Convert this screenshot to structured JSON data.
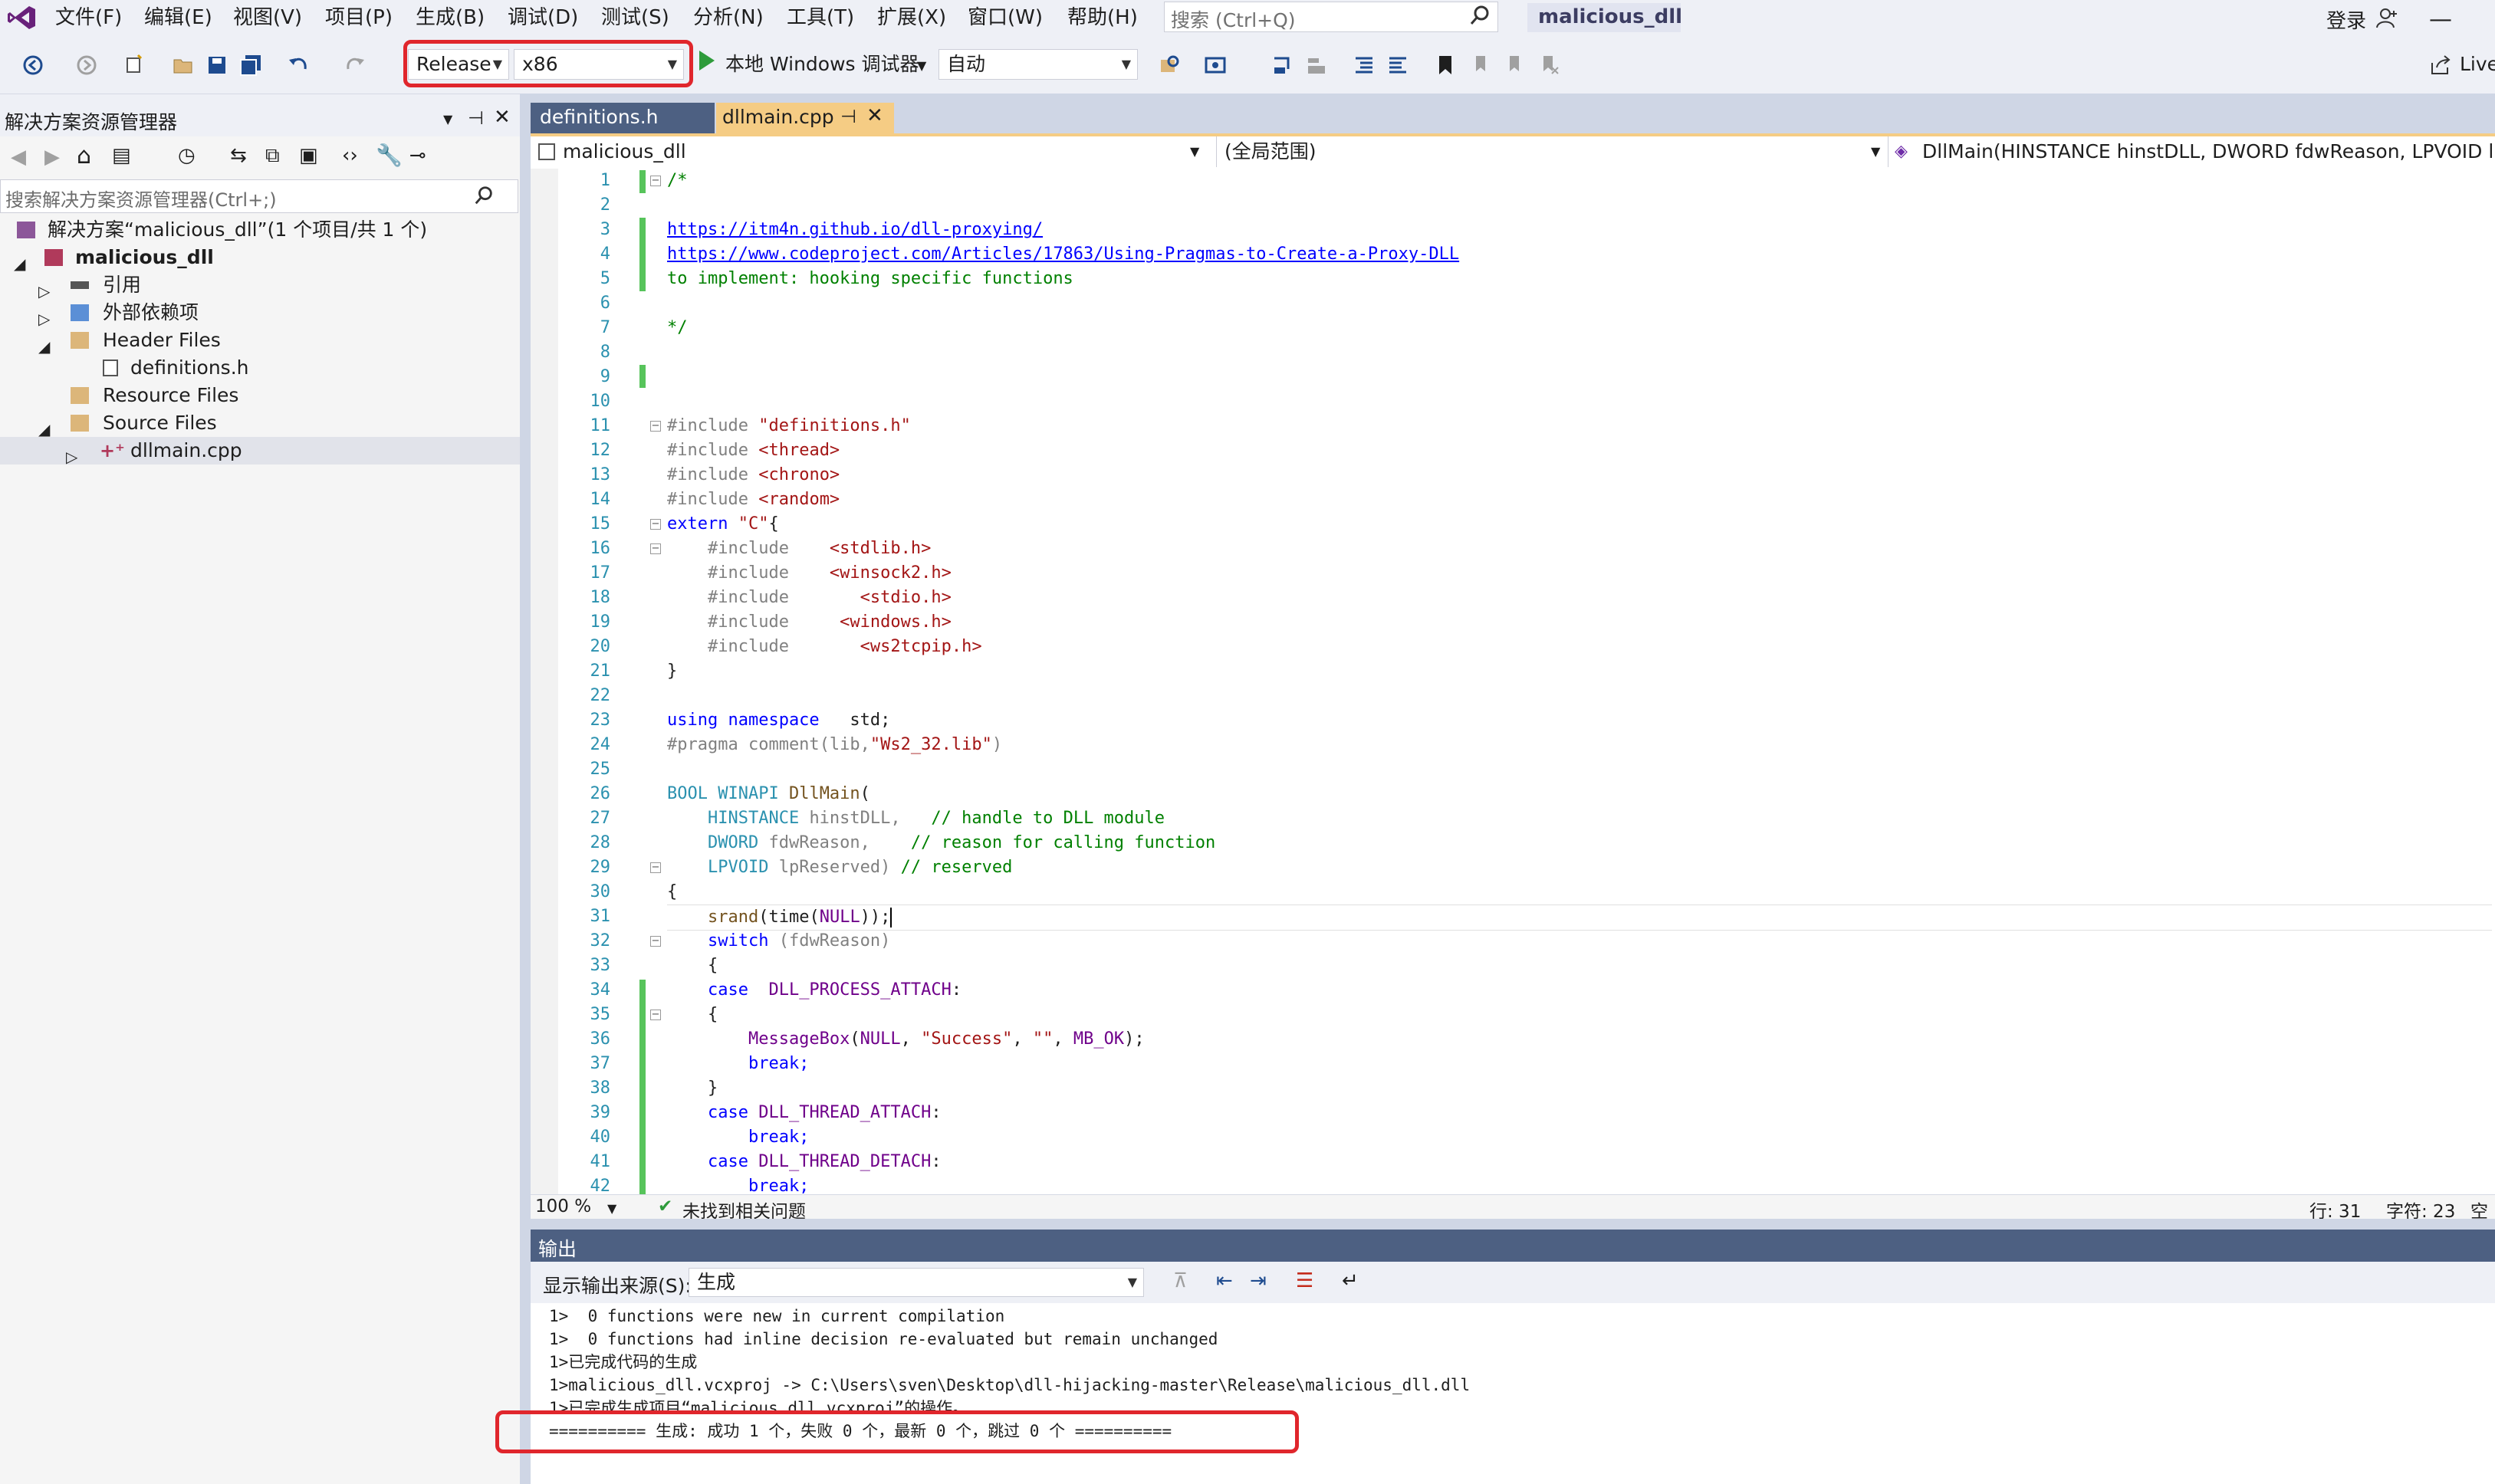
{
  "menubar": {
    "items": [
      "文件(F)",
      "编辑(E)",
      "视图(V)",
      "项目(P)",
      "生成(B)",
      "调试(D)",
      "测试(S)",
      "分析(N)",
      "工具(T)",
      "扩展(X)",
      "窗口(W)",
      "帮助(H)"
    ],
    "search_placeholder": "搜索 (Ctrl+Q)",
    "solution_name": "malicious_dll",
    "login": "登录",
    "minimize": "—"
  },
  "toolbar": {
    "config": "Release",
    "platform": "x86",
    "debugger": "本地 Windows 调试器",
    "mode": "自动",
    "live_share": "Live"
  },
  "solution_explorer": {
    "title": "解决方案资源管理器",
    "search_placeholder": "搜索解决方案资源管理器(Ctrl+;)",
    "tree": [
      "解决方案“malicious_dll”(1 个项目/共 1 个)",
      "malicious_dll",
      "引用",
      "外部依赖项",
      "Header Files",
      "definitions.h",
      "Resource Files",
      "Source Files",
      "dllmain.cpp"
    ]
  },
  "tabs": [
    {
      "label": "definitions.h"
    },
    {
      "label": "dllmain.cpp"
    }
  ],
  "navbar": {
    "project": "malicious_dll",
    "scope": "(全局范围)",
    "member": "DllMain(HINSTANCE hinstDLL, DWORD fdwReason, LPVOID lpRes"
  },
  "editor": {
    "line_numbers": [
      "1",
      "2",
      "3",
      "4",
      "5",
      "6",
      "7",
      "8",
      "9",
      "10",
      "11",
      "12",
      "13",
      "14",
      "15",
      "16",
      "17",
      "18",
      "19",
      "20",
      "21",
      "22",
      "23",
      "24",
      "25",
      "26",
      "27",
      "28",
      "29",
      "30",
      "31",
      "32",
      "33",
      "34",
      "35",
      "36",
      "37",
      "38",
      "39",
      "40",
      "41",
      "42"
    ],
    "lines": {
      "l1": "/*",
      "l3": "https://itm4n.github.io/dll-proxying/",
      "l4": "https://www.codeproject.com/Articles/17863/Using-Pragmas-to-Create-a-Proxy-DLL",
      "l5": "to implement: hooking specific functions",
      "l7": "*/",
      "l11a": "#include ",
      "l11b": "\"definitions.h\"",
      "l12a": "#include ",
      "l12b": "<thread>",
      "l13a": "#include ",
      "l13b": "<chrono>",
      "l14a": "#include ",
      "l14b": "<random>",
      "l15a": "extern ",
      "l15b": "\"C\"",
      "l15c": "{",
      "l16a": "    #include    ",
      "l16b": "<stdlib.h>",
      "l17a": "    #include    ",
      "l17b": "<winsock2.h>",
      "l18a": "    #include       ",
      "l18b": "<stdio.h>",
      "l19a": "    #include     ",
      "l19b": "<windows.h>",
      "l20a": "    #include       ",
      "l20b": "<ws2tcpip.h>",
      "l21": "}",
      "l23a": "using namespace",
      "l23b": "   std;",
      "l24a": "#pragma comment",
      "l24b": "(lib,",
      "l24c": "\"Ws2_32.lib\"",
      "l24d": ")",
      "l26a": "BOOL WINAPI ",
      "l26b": "DllMain",
      "l26c": "(",
      "l27a": "    HINSTANCE ",
      "l27b": "hinstDLL,",
      "l27c": "   // handle to DLL module",
      "l28a": "    DWORD ",
      "l28b": "fdwReason,",
      "l28c": "    // reason for calling function",
      "l29a": "    LPVOID ",
      "l29b": "lpReserved)",
      "l29c": " // reserved",
      "l30": "{",
      "l31a": "    srand",
      "l31b": "(time(",
      "l31c": "NULL",
      "l31d": "));",
      "l32a": "    switch ",
      "l32b": "(fdwReason)",
      "l33": "    {",
      "l34a": "    case  ",
      "l34b": "DLL_PROCESS_ATTACH",
      "l34c": ":",
      "l35": "    {",
      "l36a": "        MessageBox",
      "l36b": "(",
      "l36c": "NULL",
      "l36d": ", ",
      "l36e": "\"Success\"",
      "l36f": ", ",
      "l36g": "\"\"",
      "l36h": ", ",
      "l36i": "MB_OK",
      "l36j": ");",
      "l37": "        break;",
      "l38": "    }",
      "l39a": "    case ",
      "l39b": "DLL_THREAD_ATTACH",
      "l39c": ":",
      "l40": "        break;",
      "l41a": "    case ",
      "l41b": "DLL_THREAD_DETACH",
      "l41c": ":",
      "l42": "        break;"
    }
  },
  "editor_status": {
    "zoom": "100 %",
    "issues": "未找到相关问题",
    "line": "行: 31",
    "char": "字符: 23",
    "space": "空"
  },
  "output": {
    "title": "输出",
    "source_label": "显示输出来源(S):",
    "source_value": "生成",
    "lines": [
      "1>  0 functions were new in current compilation",
      "1>  0 functions had inline decision re-evaluated but remain unchanged",
      "1>已完成代码的生成",
      "1>malicious_dll.vcxproj -> C:\\Users\\sven\\Desktop\\dll-hijacking-master\\Release\\malicious_dll.dll",
      "1>已完成生成项目“malicious_dll.vcxproj”的操作。",
      "========== 生成: 成功 1 个，失败 0 个，最新 0 个，跳过 0 个 =========="
    ]
  },
  "colors": {
    "accent": "#4d6082",
    "tab_active": "#f5cc84",
    "highlight_box": "#e0262c",
    "change_bar": "#57c45b"
  }
}
